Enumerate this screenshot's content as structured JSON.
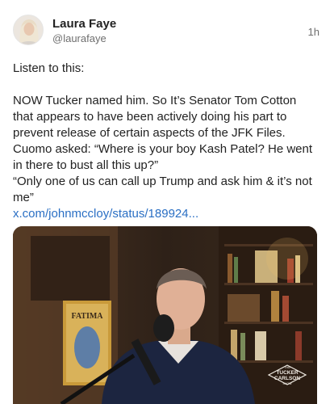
{
  "post": {
    "author": {
      "display_name": "Laura Faye",
      "handle": "@laurafaye"
    },
    "timestamp": "1h",
    "intro": "Listen to this:",
    "lines": [
      "NOW Tucker named him. So It’s Senator Tom Cotton that appears to have been actively doing his part to prevent release of certain aspects of the JFK Files.",
      "Cuomo asked: “Where is your boy Kash Patel? He went in there to bust all this up?”",
      "“Only one of us can call up Trump and ask him & it’s not me”"
    ],
    "link_text": "x.com/johnmccloy/status/189924...",
    "media": {
      "poster_text": "FATIMA",
      "watermark_top": "THE",
      "watermark_line1": "TUCKER",
      "watermark_line2": "CARLSON",
      "watermark_bottom": "SHOW"
    }
  },
  "colors": {
    "link": "#2a6fc4",
    "text": "#222222",
    "muted": "#6f6f6f"
  }
}
